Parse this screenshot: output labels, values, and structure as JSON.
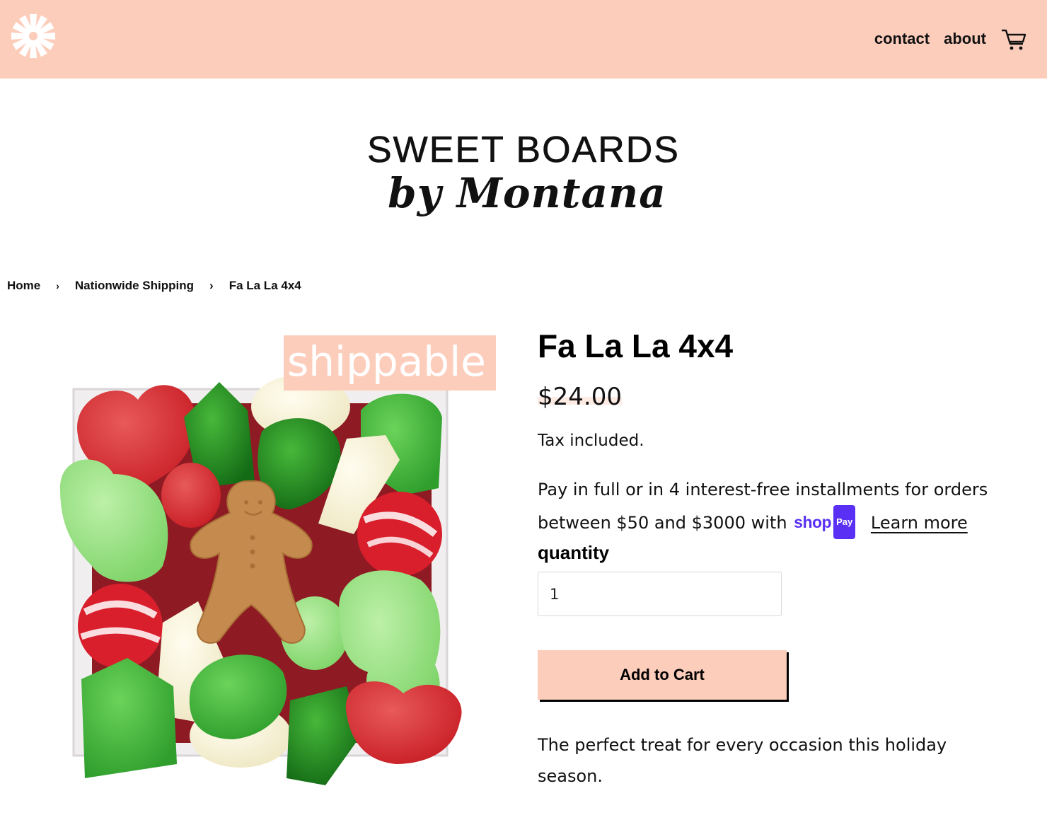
{
  "header": {
    "logo_icon": "pinwheel-logo-icon",
    "nav": [
      {
        "label": "contact"
      },
      {
        "label": "about"
      }
    ],
    "cart_icon": "shopping-cart-icon",
    "background_color": "#fdcdbc"
  },
  "brand": {
    "line1": "SWEET BOARDS",
    "line2": "by Montana"
  },
  "breadcrumb": {
    "items": [
      {
        "label": "Home"
      },
      {
        "label": "Nationwide Shipping"
      },
      {
        "label": "Fa La La 4x4"
      }
    ],
    "separator": "›"
  },
  "product": {
    "image_alt": "Box of holiday gummy candies with gingerbread man",
    "badge": "shippable",
    "title": "Fa La La 4x4",
    "price": "$24.00",
    "tax_note": "Tax included.",
    "installments_text": "Pay in full or in 4 interest-free installments for orders between $50 and $3000 with",
    "shoppay_shop": "shop",
    "shoppay_pay": "Pay",
    "learn_more": "Learn more",
    "quantity_label": "quantity",
    "quantity_value": "1",
    "add_to_cart": "Add to Cart",
    "description": "The perfect treat for every occasion this holiday season."
  },
  "colors": {
    "accent": "#fdcdbc",
    "shoppay": "#5a31f4"
  }
}
